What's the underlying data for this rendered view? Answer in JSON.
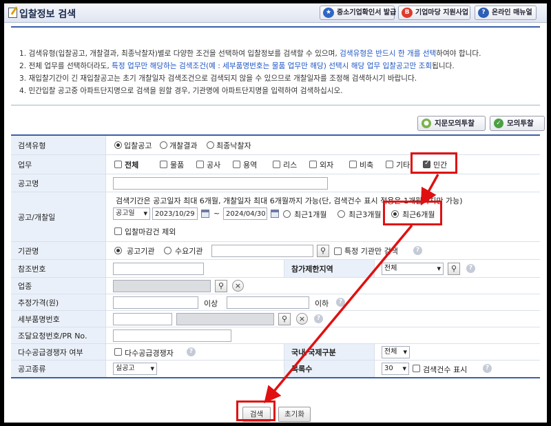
{
  "title": "입찰정보 검색",
  "header_buttons": [
    {
      "label": "중소기업확인서 발급",
      "icon": "certificate-icon"
    },
    {
      "label": "기업마당 지원사업",
      "icon": "bizinfo-icon"
    },
    {
      "label": "온라인 매뉴얼",
      "icon": "help-icon"
    }
  ],
  "notice": {
    "line1": "1. 검색유형(입찰공고, 개찰결과, 최종낙찰자)별로 다양한 조건을 선택하여 입찰정보를 검색할 수 있으며, ",
    "line1_blue": "검색유형은 반드시 한 개를 선택",
    "line1_end": "하여야 합니다.",
    "line2": "2. 전체 업무를 선택하더라도, ",
    "line2_blue": "특정 업무만 해당하는 검색조건(예 : 세부품명번호는 물품 업무만 해당) 선택시 해당 업무 입찰공고만 조회",
    "line2_end": "됩니다.",
    "line3": "3. 재입찰기간이 긴 재입찰공고는 초기 개찰일자 검색조건으로 검색되지 않을 수 있으므로 개찰일자를 조정해 검색하시기 바랍니다.",
    "line4": "4. 민간입찰 공고중 아파트단지명으로 검색을 원할 경우, 기관명에 아파트단지명을 입력하여 검색하십시오."
  },
  "actions": {
    "mock_tender": "지문모의투찰",
    "mock_bid": "모의투찰"
  },
  "form": {
    "search_type": {
      "label": "검색유형",
      "options": [
        "입찰공고",
        "개찰결과",
        "최종낙찰자"
      ],
      "selected": "입찰공고"
    },
    "business": {
      "label": "업무",
      "options": [
        "전체",
        "물품",
        "공사",
        "용역",
        "리스",
        "외자",
        "비축",
        "기타",
        "민간"
      ],
      "checked": "민간"
    },
    "notice_name": {
      "label": "공고명",
      "value": ""
    },
    "date": {
      "label": "공고/개찰일",
      "desc": "검색기간은 공고일자 최대 6개월, 개찰일자 최대 6개월까지 가능(단, 검색건수 표시 적용은 1개월까지만 가능)",
      "type": "공고일",
      "from": "2023/10/29",
      "sep": "~",
      "to": "2024/04/30",
      "ranges": [
        "최근1개월",
        "최근3개월",
        "최근6개월"
      ],
      "selected_range": "최근6개월",
      "exclude_closed": "입찰마감건 제외"
    },
    "agency": {
      "label": "기관명",
      "options": [
        "공고기관",
        "수요기관"
      ],
      "selected": "공고기관",
      "value": "",
      "only_label": "특정 기관만 검색"
    },
    "ref_no": {
      "label": "참조번호",
      "value": ""
    },
    "region": {
      "label": "참가제한지역",
      "value": "전체"
    },
    "industry": {
      "label": "업종"
    },
    "price": {
      "label": "추정가격(원)",
      "min_suffix": "이상",
      "max_suffix": "이하"
    },
    "item_no": {
      "label": "세부품명번호"
    },
    "pr_no": {
      "label": "조달요청번호/PR No."
    },
    "multi": {
      "label": "다수공급경쟁자 여부",
      "check_label": "다수공급경쟁자"
    },
    "intl": {
      "label": "국내/국제구분",
      "value": "전체"
    },
    "kind": {
      "label": "공고종류",
      "value": "실공고"
    },
    "count": {
      "label": "목록수",
      "value": "30",
      "show_count": "검색건수 표시"
    }
  },
  "buttons": {
    "search": "검색",
    "reset": "초기화"
  },
  "colors": {
    "accent": "#3a5ea8",
    "label_bg": "#eaf0f9",
    "highlight": "#e01010",
    "link": "#1f56c6"
  }
}
